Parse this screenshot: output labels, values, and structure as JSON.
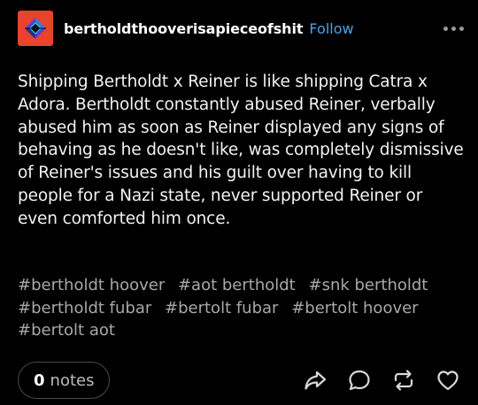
{
  "post": {
    "blog_name": "bertholdthooverisapieceofshit",
    "follow_label": "Follow",
    "body": "Shipping Bertholdt x Reiner is like shipping Catra x Adora. Bertholdt constantly abused Reiner, verbally abused him as soon as Reiner displayed any signs of behaving as he doesn't like, was completely dismissive of Reiner's issues and his guilt over having to kill people for a Nazi state, never supported Reiner or even comforted him once.",
    "tags": [
      "#bertholdt hoover",
      "#aot bertholdt",
      "#snk bertholdt",
      "#bertholdt fubar",
      "#bertolt fubar",
      "#bertolt hoover",
      "#bertolt aot"
    ],
    "notes": {
      "count": "0",
      "label": "notes"
    }
  },
  "icons": {
    "avatar": "diamond-logo-icon",
    "more": "more-dots-icon",
    "share": "share-icon",
    "reply": "reply-icon",
    "reblog": "reblog-icon",
    "like": "heart-icon"
  },
  "colors": {
    "background": "#000000",
    "avatar": "#e8432c",
    "follow": "#4aa3e8",
    "tag": "#a8a8a8"
  }
}
